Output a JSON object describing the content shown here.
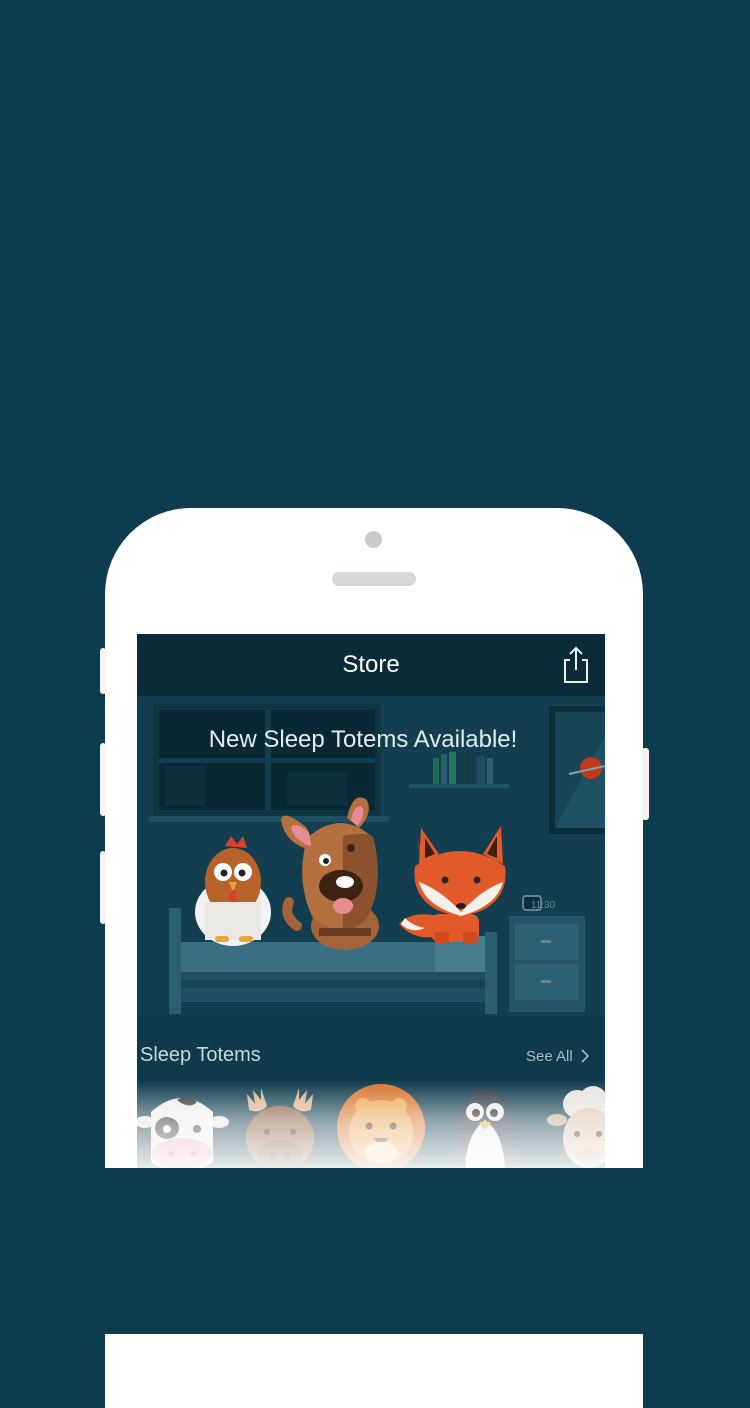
{
  "store": {
    "title": "Store",
    "banner_text": "New Sleep Totems Available!",
    "clock_time": "11:30"
  },
  "section": {
    "title": "Sleep Totems",
    "see_all": "See All"
  },
  "totems": [
    {
      "name": "cow"
    },
    {
      "name": "moose"
    },
    {
      "name": "lion"
    },
    {
      "name": "penguin"
    },
    {
      "name": "sheep"
    }
  ],
  "colors": {
    "background": "#0c3c4e",
    "navbar": "#0b2b39",
    "fox": "#e2592a",
    "dog": "#a5633a"
  }
}
